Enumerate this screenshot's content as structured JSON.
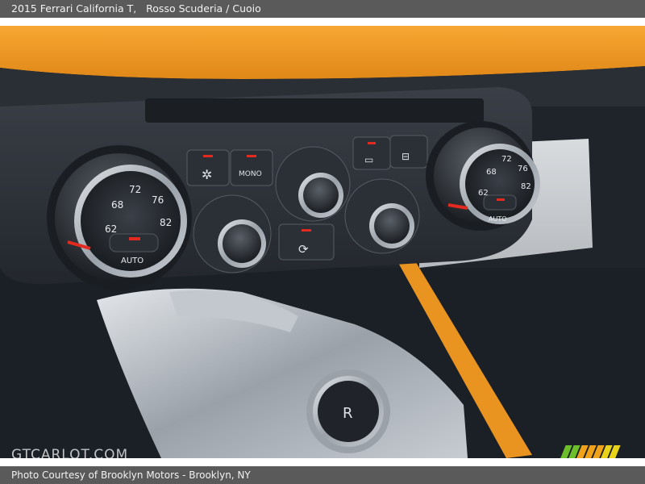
{
  "caption": {
    "vehicle": "2015 Ferrari California T,",
    "color": "Rosso Scuderia / Cuoio"
  },
  "credit": "Photo Courtesy of Brooklyn Motors  - Brooklyn, NY",
  "watermark": "GTCARLOT.COM",
  "stripe_colors": [
    "#6cbf2a",
    "#6cbf2a",
    "#f0a21a",
    "#f0a21a",
    "#f0a21a",
    "#e8d21a",
    "#e8d21a"
  ],
  "controls": {
    "left_dial": {
      "temps": [
        "62",
        "68",
        "72",
        "76",
        "82"
      ],
      "button_label": "AUTO"
    },
    "right_dial": {
      "temps": [
        "62",
        "68",
        "72",
        "76",
        "82"
      ],
      "button_label": "AUTO"
    },
    "mono_button_label": "MONO",
    "gear_button_label": "R"
  },
  "colors": {
    "orange_trim": "#f0931e",
    "accent_red": "#e22a20",
    "accent_blue": "#3a6cd8"
  }
}
